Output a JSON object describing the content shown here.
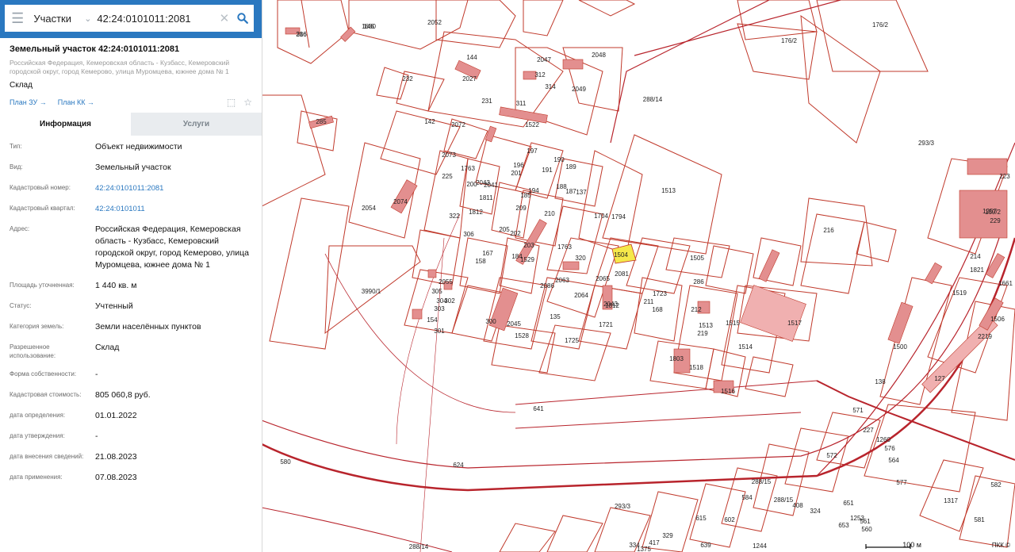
{
  "search": {
    "category": "Участки",
    "value": "42:24:0101011:2081"
  },
  "parcel": {
    "title": "Земельный участок 42:24:0101011:2081",
    "address_short": "Российская Федерация, Кемеровская область - Кузбасс, Кемеровский городской округ, город Кемерово, улица Муромцева, южнее дома № 1",
    "subtype": "Склад",
    "link_plan_zu": "План ЗУ →",
    "link_plan_kk": "План КК →"
  },
  "tabs": {
    "info": "Информация",
    "services": "Услуги"
  },
  "info_rows": [
    {
      "label": "Тип:",
      "value": "Объект недвижимости"
    },
    {
      "label": "Вид:",
      "value": "Земельный участок"
    },
    {
      "label": "Кадастровый номер:",
      "value": "42:24:0101011:2081"
    },
    {
      "label": "Кадастровый квартал:",
      "value": "42:24:0101011"
    },
    {
      "label": "Адрес:",
      "value": "Российская Федерация, Кемеровская область - Кузбасс, Кемеровский городской округ, город Кемерово, улица Муромцева, южнее дома № 1"
    },
    {
      "label": "Площадь уточненная:",
      "value": "1 440 кв. м"
    },
    {
      "label": "Статус:",
      "value": "Учтенный"
    },
    {
      "label": "Категория земель:",
      "value": "Земли населённых пунктов"
    },
    {
      "label": "Разрешенное использование:",
      "value": "Склад"
    },
    {
      "label": "Форма собственности:",
      "value": "-"
    },
    {
      "label": "Кадастровая стоимость:",
      "value": "805 060,8 руб."
    },
    {
      "label": "дата определения:",
      "value": "01.01.2022"
    },
    {
      "label": "дата утверждения:",
      "value": "-"
    },
    {
      "label": "дата внесения сведений:",
      "value": "21.08.2023"
    },
    {
      "label": "дата применения:",
      "value": "07.08.2023"
    }
  ],
  "map": {
    "labels": [
      "316",
      "146",
      "2052",
      "176/2",
      "176/2",
      "144",
      "2047",
      "2048",
      "312",
      "314",
      "2049",
      "311",
      "232",
      "231",
      "2027",
      "285",
      "142",
      "2072",
      "2073",
      "1522",
      "288/14",
      "293/3",
      "197",
      "196",
      "191",
      "190",
      "189",
      "188",
      "187",
      "137",
      "225",
      "201",
      "1763",
      "200",
      "2043",
      "2041",
      "194",
      "1513",
      "1794",
      "2054",
      "2074",
      "185",
      "1812",
      "1811",
      "209",
      "210",
      "1704",
      "216",
      "1257",
      "229",
      "223",
      "322",
      "306",
      "205",
      "167",
      "158",
      "202",
      "184",
      "203",
      "1529",
      "1763",
      "320",
      "1504",
      "2081",
      "1505",
      "286",
      "214",
      "1812",
      "1821",
      "1519",
      "1661",
      "3990/1",
      "2055",
      "305",
      "304",
      "303",
      "302",
      "154",
      "301",
      "300",
      "2045",
      "1528",
      "135",
      "1725",
      "2086",
      "2063",
      "2064",
      "2065",
      "2043",
      "1721",
      "1723",
      "211",
      "168",
      "212",
      "1513",
      "1515",
      "1517",
      "219",
      "1803",
      "1518",
      "1514",
      "1516",
      "169/2",
      "1506",
      "2219",
      "1500",
      "138",
      "127",
      "571",
      "227",
      "1260",
      "576",
      "564",
      "572",
      "577",
      "580",
      "624",
      "293/3",
      "288/14",
      "288/15",
      "288/15",
      "408",
      "324",
      "1253",
      "651",
      "653",
      "561",
      "560",
      "1317",
      "581",
      "582",
      "584",
      "602",
      "615",
      "329",
      "417",
      "334",
      "1375",
      "639",
      "1244",
      "641",
      "286",
      "1680"
    ],
    "scale": "100 м",
    "copyright": "ПКК ©"
  },
  "colors": {
    "accent": "#2a78c0",
    "parcel_line": "#c0392b",
    "building_fill": "#e38f8f",
    "selected": "#f5e84a"
  }
}
